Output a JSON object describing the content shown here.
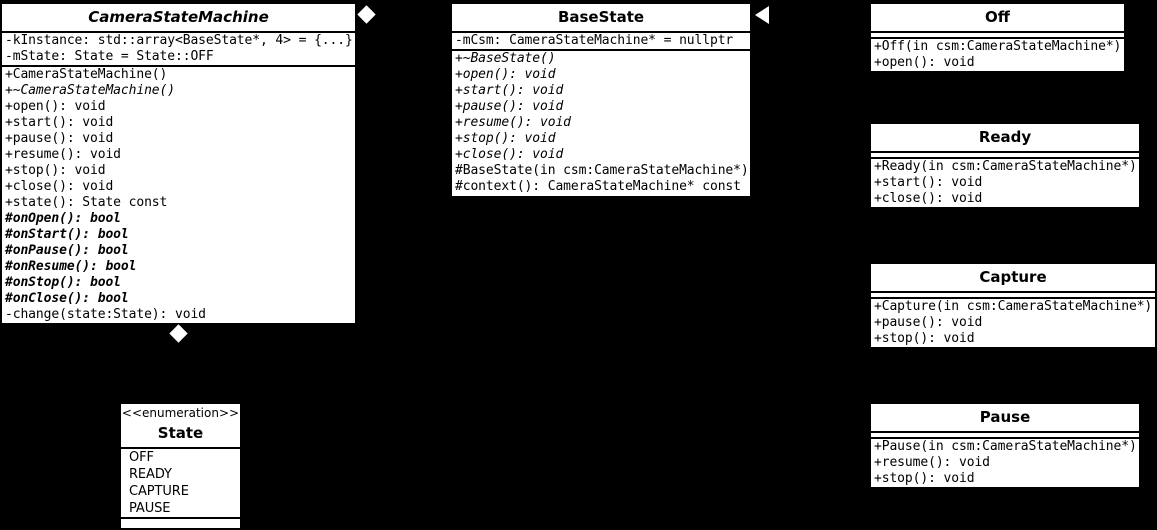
{
  "diagram": {
    "kind": "uml-class-diagram",
    "background": "#000000",
    "foreground": "#ffffff",
    "box_fill": "#ffffff",
    "box_stroke": "#000000"
  },
  "classes": {
    "camera_state_machine": {
      "title": "CameraStateMachine",
      "abstract": true,
      "attributes": [
        "-kInstance: std::array<BaseState*, 4> = {...}",
        "-mState: State = State::OFF"
      ],
      "operations": [
        {
          "text": "+CameraStateMachine()",
          "style": "normal"
        },
        {
          "text": "+~CameraStateMachine()",
          "style": "italic"
        },
        {
          "text": "+open(): void",
          "style": "normal"
        },
        {
          "text": "+start(): void",
          "style": "normal"
        },
        {
          "text": "+pause(): void",
          "style": "normal"
        },
        {
          "text": "+resume(): void",
          "style": "normal"
        },
        {
          "text": "+stop(): void",
          "style": "normal"
        },
        {
          "text": "+close(): void",
          "style": "normal"
        },
        {
          "text": "+state(): State const",
          "style": "normal"
        },
        {
          "text": "#onOpen(): bool",
          "style": "bolditalic"
        },
        {
          "text": "#onStart(): bool",
          "style": "bolditalic"
        },
        {
          "text": "#onPause(): bool",
          "style": "bolditalic"
        },
        {
          "text": "#onResume(): bool",
          "style": "bolditalic"
        },
        {
          "text": "#onStop(): bool",
          "style": "bolditalic"
        },
        {
          "text": "#onClose(): bool",
          "style": "bolditalic"
        },
        {
          "text": "-change(state:State): void",
          "style": "normal"
        }
      ]
    },
    "base_state": {
      "title": "BaseState",
      "abstract": false,
      "attributes": [
        "-mCsm: CameraStateMachine* = nullptr"
      ],
      "operations": [
        {
          "text": "+~BaseState()",
          "style": "italic"
        },
        {
          "text": "+open(): void",
          "style": "italic"
        },
        {
          "text": "+start(): void",
          "style": "italic"
        },
        {
          "text": "+pause(): void",
          "style": "italic"
        },
        {
          "text": "+resume(): void",
          "style": "italic"
        },
        {
          "text": "+stop(): void",
          "style": "italic"
        },
        {
          "text": "+close(): void",
          "style": "italic"
        },
        {
          "text": "#BaseState(in csm:CameraStateMachine*)",
          "style": "normal"
        },
        {
          "text": "#context(): CameraStateMachine* const",
          "style": "normal"
        }
      ]
    },
    "off": {
      "title": "Off",
      "attributes": [],
      "operations": [
        {
          "text": "+Off(in csm:CameraStateMachine*)",
          "style": "normal"
        },
        {
          "text": "+open(): void",
          "style": "normal"
        }
      ]
    },
    "ready": {
      "title": "Ready",
      "attributes": [],
      "operations": [
        {
          "text": "+Ready(in csm:CameraStateMachine*)",
          "style": "normal"
        },
        {
          "text": "+start(): void",
          "style": "normal"
        },
        {
          "text": "+close(): void",
          "style": "normal"
        }
      ]
    },
    "capture": {
      "title": "Capture",
      "attributes": [],
      "operations": [
        {
          "text": "+Capture(in csm:CameraStateMachine*)",
          "style": "normal"
        },
        {
          "text": "+pause(): void",
          "style": "normal"
        },
        {
          "text": "+stop(): void",
          "style": "normal"
        }
      ]
    },
    "pause": {
      "title": "Pause",
      "attributes": [],
      "operations": [
        {
          "text": "+Pause(in csm:CameraStateMachine*)",
          "style": "normal"
        },
        {
          "text": "+resume(): void",
          "style": "normal"
        },
        {
          "text": "+stop(): void",
          "style": "normal"
        }
      ]
    },
    "state_enum": {
      "stereotype": "<<enumeration>>",
      "title": "State",
      "literals": [
        "OFF",
        "READY",
        "CAPTURE",
        "PAUSE"
      ]
    }
  },
  "connectors": {
    "csm_aggregation_diamond": "filled-white-diamond",
    "csm_state_composition_diamond": "filled-white-diamond",
    "basestate_generalization_arrow": "hollow-triangle-left"
  }
}
